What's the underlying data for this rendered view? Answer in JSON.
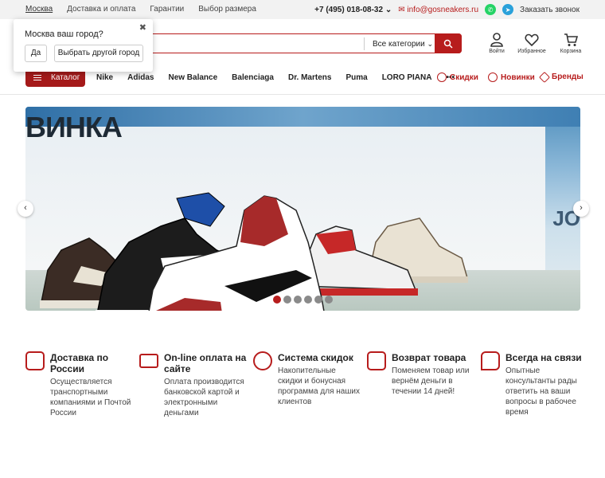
{
  "topbar": {
    "city": "Москва",
    "links": [
      "Доставка и оплата",
      "Гарантии",
      "Выбор размера"
    ],
    "phone": "+7 (495) 018-08-32",
    "email": "info@gosneakers.ru",
    "callback": "Заказать звонок"
  },
  "search": {
    "placeholder": "",
    "category": "Все категории"
  },
  "header_icons": {
    "login": "Войти",
    "favorites": "Избранное",
    "cart": "Корзина"
  },
  "city_popup": {
    "question": "Москва ваш город?",
    "yes": "Да",
    "other": "Выбрать другой город"
  },
  "nav": {
    "catalog": "Каталог",
    "brands": [
      "Nike",
      "Adidas",
      "New Balance",
      "Balenciaga",
      "Dr. Martens",
      "Puma",
      "LORO PIANA"
    ],
    "more": "•••",
    "sale": "Скидки",
    "new": "Новинки",
    "brands_link": "Бренды"
  },
  "banner": {
    "headline": "ВИНКА",
    "side_word": "JO",
    "slide_count": 6,
    "active_slide": 1
  },
  "features": [
    {
      "title": "Доставка по России",
      "desc": "Осуществляется транспортными компаниями и Почтой России"
    },
    {
      "title": "On-line оплата на сайте",
      "desc": "Оплата производится банковской картой и электронными деньгами"
    },
    {
      "title": "Система скидок",
      "desc": "Накопительные скидки и бонусная программа для наших клиентов"
    },
    {
      "title": "Возврат товара",
      "desc": "Поменяем товар или вернём деньги в течении 14 дней!"
    },
    {
      "title": "Всегда на связи",
      "desc": "Опытные консультанты рады ответить на ваши вопросы в рабочее время"
    }
  ],
  "colors": {
    "accent": "#b71c1c",
    "topbar_bg": "#f2f2f2"
  }
}
